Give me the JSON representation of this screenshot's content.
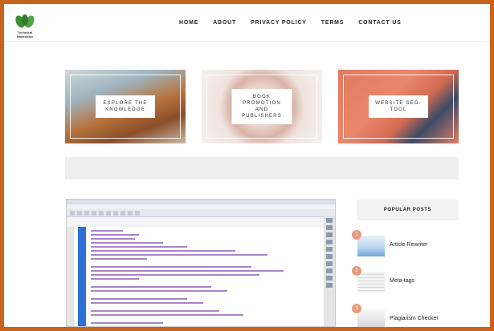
{
  "site": {
    "logo_text": "Technical Nadeshiko"
  },
  "nav": {
    "items": [
      "HOME",
      "ABOUT",
      "PRIVACY POLICY",
      "TERMS",
      "CONTACT US"
    ]
  },
  "featured": [
    {
      "line1": "EXPLORE THE",
      "line2": "KNOWLEDGE"
    },
    {
      "line1": "BOOK",
      "line2": "PROMOTION AND",
      "line3": "PUBLISHERS"
    },
    {
      "line1": "WEBSITE SEO-",
      "line2": "TOOL"
    }
  ],
  "popular_posts": {
    "heading": "POPULAR POSTS",
    "items": [
      {
        "rank": "1",
        "title": "Article Rewriter"
      },
      {
        "rank": "2",
        "title": "Meta-tags"
      },
      {
        "rank": "3",
        "title": "Plagiarism Checker"
      }
    ]
  },
  "colors": {
    "border": "#c7631d",
    "accent_badge": "#e79a7f",
    "code_blue": "#2f6fd6"
  }
}
